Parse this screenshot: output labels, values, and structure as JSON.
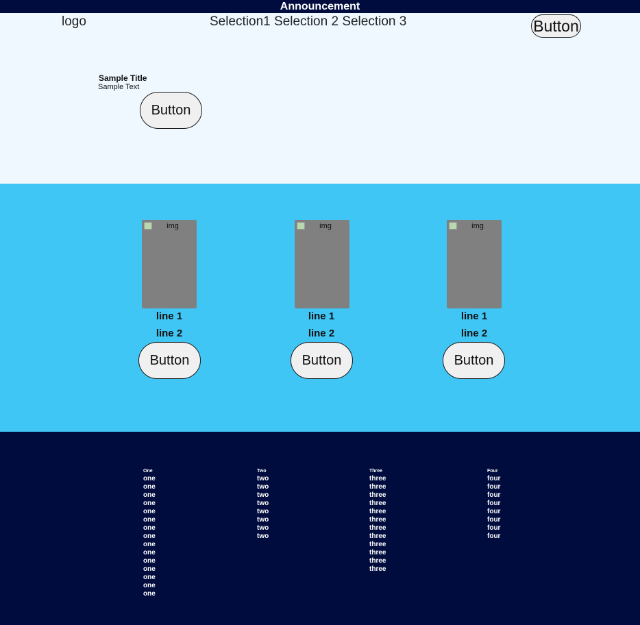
{
  "announcement": "Announcement",
  "header": {
    "logo": "logo",
    "nav": [
      "Selection1",
      "Selection 2",
      "Selection 3"
    ],
    "button_label": "Button"
  },
  "hero": {
    "title": "Sample Title",
    "text": "Sample Text",
    "button_label": "Button"
  },
  "cards": [
    {
      "img_alt": "img",
      "line1": "line 1",
      "line2": "line 2",
      "button_label": "Button"
    },
    {
      "img_alt": "img",
      "line1": "line 1",
      "line2": "line 2",
      "button_label": "Button"
    },
    {
      "img_alt": "img",
      "line1": "line 1",
      "line2": "line 2",
      "button_label": "Button"
    }
  ],
  "footer": {
    "columns": [
      {
        "heading": "One",
        "items": [
          "one",
          "one",
          "one",
          "one",
          "one",
          "one",
          "one",
          "one",
          "one",
          "one",
          "one",
          "one",
          "one",
          "one",
          "one"
        ]
      },
      {
        "heading": "Two",
        "items": [
          "two",
          "two",
          "two",
          "two",
          "two",
          "two",
          "two",
          "two"
        ]
      },
      {
        "heading": "Three",
        "items": [
          "three",
          "three",
          "three",
          "three",
          "three",
          "three",
          "three",
          "three",
          "three",
          "three",
          "three",
          "three"
        ]
      },
      {
        "heading": "Four",
        "items": [
          "four",
          "four",
          "four",
          "four",
          "four",
          "four",
          "four",
          "four"
        ]
      }
    ]
  },
  "colors": {
    "announcement_bg": "#000c3d",
    "hero_bg": "#eff8ff",
    "products_bg": "#40c6f5",
    "footer_bg": "#000c3d",
    "image_placeholder": "#808080"
  }
}
